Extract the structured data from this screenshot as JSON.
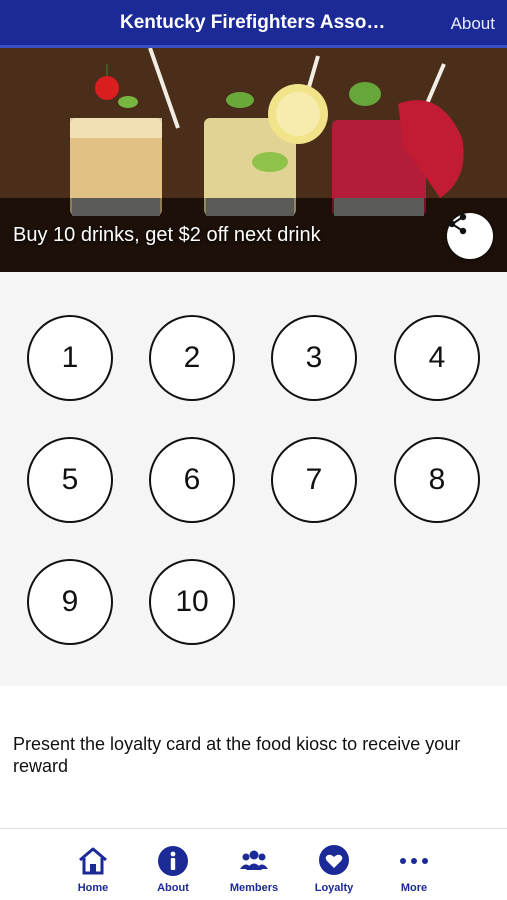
{
  "header": {
    "title": "Kentucky Firefighters Associ…",
    "about_label": "About"
  },
  "hero": {
    "caption": "Buy 10 drinks, get $2 off next drink",
    "share_icon": "share-icon"
  },
  "stamps": [
    "1",
    "2",
    "3",
    "4",
    "5",
    "6",
    "7",
    "8",
    "9",
    "10"
  ],
  "reward": {
    "text": "Present the loyalty card at the food kiosc to receive your reward"
  },
  "tabs": [
    {
      "label": "Home",
      "icon": "home-icon"
    },
    {
      "label": "About",
      "icon": "info-icon"
    },
    {
      "label": "Members",
      "icon": "members-icon"
    },
    {
      "label": "Loyalty",
      "icon": "heart-icon"
    },
    {
      "label": "More",
      "icon": "more-icon"
    }
  ],
  "colors": {
    "brand": "#1b2a96",
    "stamp_border": "#111111",
    "background": "#f5f5f5"
  }
}
